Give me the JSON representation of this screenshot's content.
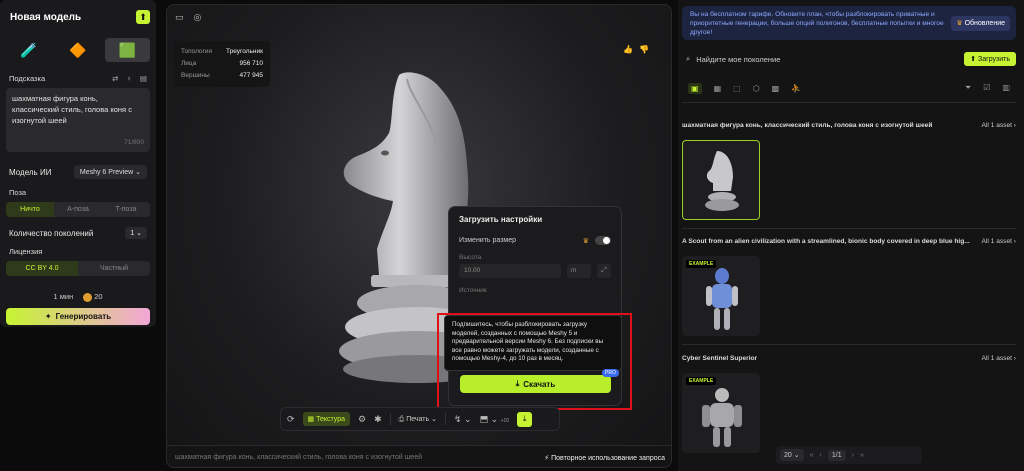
{
  "left": {
    "title": "Новая модель",
    "prompt_label": "Подсказка",
    "prompt_text": "шахматная фигура конь, классический стиль, голова коня с изогнутой шеей",
    "prompt_count": "71/800",
    "model_label": "Модель ИИ",
    "model_value": "Meshy 6 Preview",
    "pose_label": "Поза",
    "pose_options": [
      "Ничто",
      "A-поза",
      "T-поза"
    ],
    "count_label": "Количество поколений",
    "count_value": "1",
    "license_label": "Лицензия",
    "license_options": [
      "CC BY 4.0",
      "Частный"
    ],
    "time": "1 мин",
    "credits": "20",
    "generate_label": "Генерировать"
  },
  "viewport": {
    "stats": [
      {
        "k": "Топология",
        "v": "Треугольник"
      },
      {
        "k": "Лица",
        "v": "956 710"
      },
      {
        "k": "Вершины",
        "v": "477 945"
      }
    ],
    "panel_title": "Загрузить настройки",
    "resize_label": "Изменить размер",
    "height_label": "Высота",
    "height_value": "10.00",
    "unit_value": "m",
    "source_label": "Источник",
    "tooltip_text": "Подпишитесь, чтобы разблокировать загрузку моделей, созданных с помощью Meshy 5 и предварительной версии Meshy 6. Без подписки вы все равно можете загружать модели, созданные с помощью Meshy-4, до 10 раз в месяц.",
    "download_label": "Скачать",
    "pro_badge": "PRO",
    "toolbar": {
      "texture": "Текстура",
      "print": "Печать",
      "badge": "+10"
    },
    "bottom_prompt": "шахматная фигура конь, классический стиль, голова коня с изогнутой шеей",
    "reuse_label": "Повторное использование запроса"
  },
  "right": {
    "banner_text": "Вы на бесплатном тарифе. Обновите план, чтобы разблокировать приватные и приоритетные генерации, больше опций полигонов, бесплатные попытки и многое другое!",
    "upgrade_label": "Обновление",
    "search_placeholder": "Найдите мое поколение",
    "upload_label": "Загрузить",
    "generations": [
      {
        "title": "шахматная фигура конь, классический стиль, голова коня с изогнутой шеей",
        "count": "All 1 asset"
      },
      {
        "title": "A Scout from an alien civilization with a streamlined, bionic body covered in deep blue hig...",
        "count": "All 1 asset",
        "badge": "EXAMPLE"
      },
      {
        "title": "Cyber Sentinel Superior",
        "count": "All 1 asset",
        "badge": "EXAMPLE"
      }
    ],
    "pager": {
      "per_page": "20",
      "page": "1/1"
    }
  }
}
